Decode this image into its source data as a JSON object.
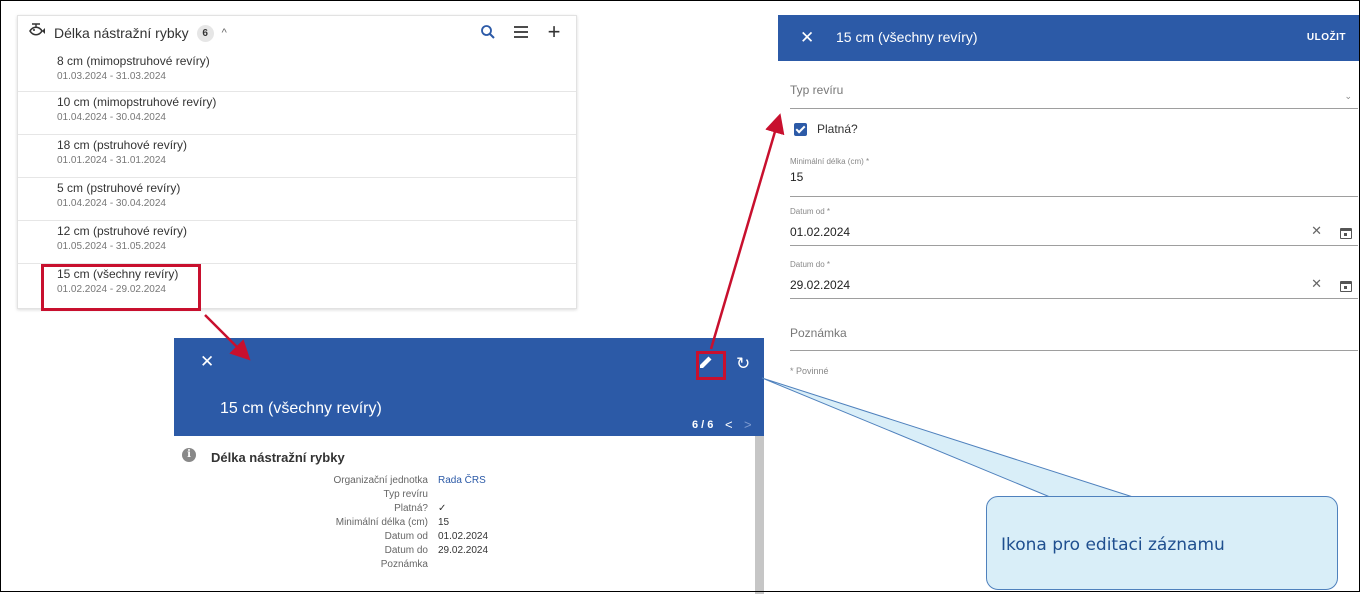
{
  "list": {
    "title": "Délka nástražní rybky",
    "count": "6",
    "items": [
      {
        "title": "8 cm (mimopstruhové revíry)",
        "dates": "01.03.2024 - 31.03.2024"
      },
      {
        "title": "10 cm (mimopstruhové revíry)",
        "dates": "01.04.2024 - 30.04.2024"
      },
      {
        "title": "18 cm (pstruhové revíry)",
        "dates": "01.01.2024 - 31.01.2024"
      },
      {
        "title": "5 cm (pstruhové revíry)",
        "dates": "01.04.2024 - 30.04.2024"
      },
      {
        "title": "12 cm (pstruhové revíry)",
        "dates": "01.05.2024 - 31.05.2024"
      },
      {
        "title": "15 cm (všechny revíry)",
        "dates": "01.02.2024 - 29.02.2024"
      }
    ]
  },
  "detail": {
    "title": "15 cm (všechny revíry)",
    "pager": "6 / 6",
    "section_title": "Délka nástražní rybky",
    "fields": [
      {
        "label": "Organizační jednotka",
        "value": "Rada ČRS"
      },
      {
        "label": "Typ revíru",
        "value": ""
      },
      {
        "label": "Platná?",
        "value": "✓"
      },
      {
        "label": "Minimální délka (cm)",
        "value": "15"
      },
      {
        "label": "Datum od",
        "value": "01.02.2024"
      },
      {
        "label": "Datum do",
        "value": "29.02.2024"
      },
      {
        "label": "Poznámka",
        "value": ""
      }
    ]
  },
  "edit_form": {
    "title": "15 cm (všechny revíry)",
    "save_label": "ULOŽIT",
    "type_label": "Typ revíru",
    "valid_label": "Platná?",
    "min_length_label": "Minimální délka (cm) *",
    "min_length_value": "15",
    "date_from_label": "Datum od *",
    "date_from_value": "01.02.2024",
    "date_to_label": "Datum do *",
    "date_to_value": "29.02.2024",
    "note_label": "Poznámka",
    "required_note": "* Povinné"
  },
  "callout": {
    "text": "Ikona pro editaci záznamu"
  },
  "colors": {
    "primary": "#2c5aa7",
    "highlight": "#c8102e",
    "callout_bg": "#d9eef8"
  }
}
